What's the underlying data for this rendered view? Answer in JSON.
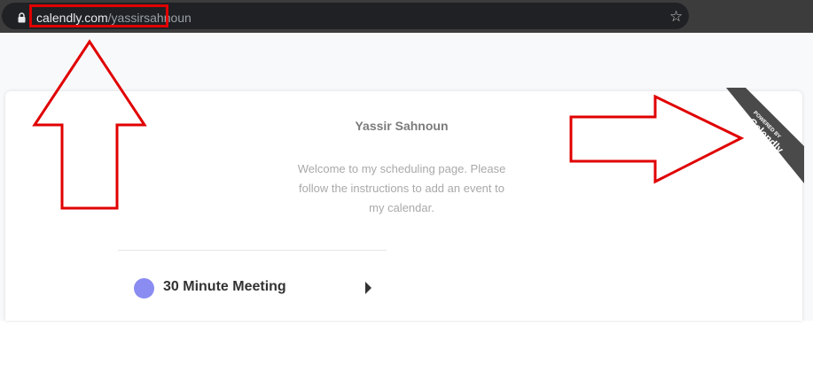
{
  "browser": {
    "url_domain": "calendly.com",
    "url_path": "/yassirsahnoun",
    "lock_icon": "lock-icon",
    "bookmark_icon": "star-icon"
  },
  "page": {
    "owner_name": "Yassir Sahnoun",
    "welcome_message": "Welcome to my scheduling page. Please follow the instructions to add an event to my calendar.",
    "events": [
      {
        "label": "30 Minute Meeting",
        "color": "#8a8cf2",
        "icon": "caret-right-icon"
      }
    ],
    "badge": {
      "line1": "POWERED BY",
      "line2": "Calendly"
    }
  },
  "annotations": {
    "color": "#e00000",
    "arrows": [
      "arrow-up",
      "arrow-right"
    ]
  }
}
